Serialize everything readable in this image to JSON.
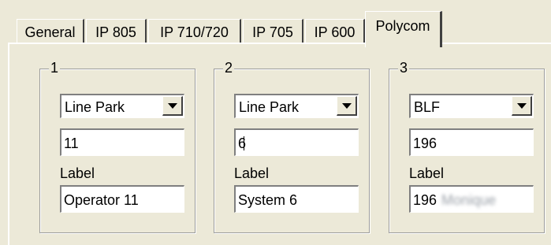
{
  "tabs": [
    {
      "label": "General",
      "active": false
    },
    {
      "label": "IP 805",
      "active": false
    },
    {
      "label": "IP 710/720",
      "active": false
    },
    {
      "label": "IP 705",
      "active": false
    },
    {
      "label": "IP 600",
      "active": false
    },
    {
      "label": "Polycom",
      "active": true
    }
  ],
  "groups": [
    {
      "title": "1",
      "type_value": "Line Park",
      "number_value": "11",
      "label_caption": "Label",
      "label_value": "Operator 11"
    },
    {
      "title": "2",
      "type_value": "Line Park",
      "number_value": "6",
      "label_caption": "Label",
      "label_value": "System 6"
    },
    {
      "title": "3",
      "type_value": "BLF",
      "number_value": "196",
      "label_caption": "Label",
      "label_value": "196",
      "label_value_obscured": "Monique"
    }
  ]
}
